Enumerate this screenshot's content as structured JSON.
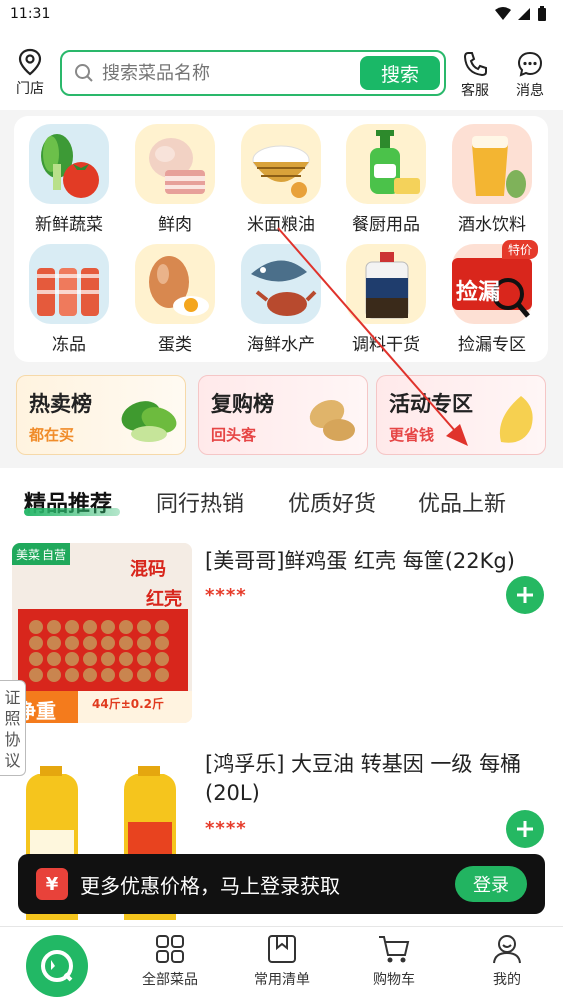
{
  "status": {
    "time": "11:31"
  },
  "header": {
    "store_label": "门店",
    "search_placeholder": "搜索菜品名称",
    "search_button": "搜索",
    "service_label": "客服",
    "message_label": "消息"
  },
  "categories": [
    {
      "label": "新鲜蔬菜",
      "icon": "vegetables-icon"
    },
    {
      "label": "鲜肉",
      "icon": "meat-icon"
    },
    {
      "label": "米面粮油",
      "icon": "rice-icon"
    },
    {
      "label": "餐厨用品",
      "icon": "kitchen-supplies-icon"
    },
    {
      "label": "酒水饮料",
      "icon": "beverage-icon"
    },
    {
      "label": "冻品",
      "icon": "frozen-food-icon"
    },
    {
      "label": "蛋类",
      "icon": "egg-icon"
    },
    {
      "label": "海鲜水产",
      "icon": "seafood-icon"
    },
    {
      "label": "调料干货",
      "icon": "seasoning-icon"
    },
    {
      "label": "捡漏专区",
      "icon": "bargain-icon",
      "badge": "特价",
      "img_text": "捡漏"
    }
  ],
  "rankings": [
    {
      "title": "热卖榜",
      "subtitle": "都在买",
      "color": "#f08c2a"
    },
    {
      "title": "复购榜",
      "subtitle": "回头客",
      "color": "#e64545"
    },
    {
      "title": "活动专区",
      "subtitle": "更省钱",
      "color": "#e64545"
    }
  ],
  "tabs": [
    "精品推荐",
    "同行热销",
    "优质好货",
    "优品上新"
  ],
  "products": [
    {
      "name": "[美哥哥]鲜鸡蛋 红壳 每筐(22Kg)",
      "price": "****",
      "img_badge": "美菜",
      "img_badge2": "自营",
      "img_tag1": "混码",
      "img_tag2": "红壳",
      "img_weight_label": "净重",
      "img_weight": "44斤±0.2斤"
    },
    {
      "name": "[鸿孚乐] 大豆油 转基因 一级 每桶(20L)",
      "price": "****"
    }
  ],
  "cert_tab": "证照协议",
  "login_banner": {
    "text": "更多优惠价格，马上登录获取",
    "button": "登录",
    "logo": "¥"
  },
  "bottom_nav": [
    {
      "label": "全部菜品",
      "icon": "grid-icon"
    },
    {
      "label": "常用清单",
      "icon": "bookmark-icon"
    },
    {
      "label": "购物车",
      "icon": "cart-icon"
    },
    {
      "label": "我的",
      "icon": "user-icon"
    }
  ]
}
